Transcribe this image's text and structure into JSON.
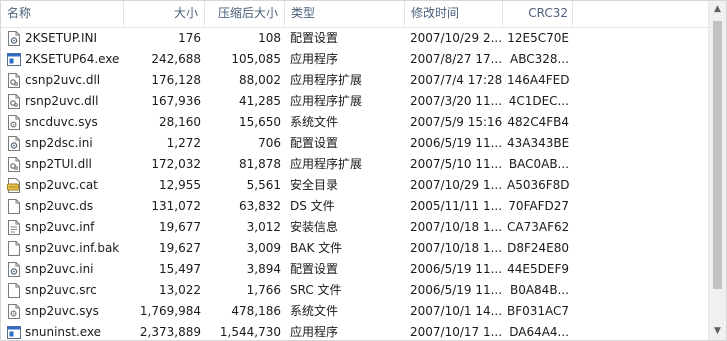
{
  "columns": {
    "name": "名称",
    "size": "大小",
    "compressed": "压缩后大小",
    "type": "类型",
    "modified": "修改时间",
    "crc": "CRC32"
  },
  "scrollbar": {
    "up": "▲",
    "down": "▼"
  },
  "sort_arrow": "^",
  "files": [
    {
      "icon": "ini-settings-icon",
      "name": "2KSETUP.INI",
      "size": "176",
      "compressed": "108",
      "type": "配置设置",
      "modified": "2007/10/29 2...",
      "crc": "12E5C70E"
    },
    {
      "icon": "exe-app-icon",
      "name": "2KSETUP64.exe",
      "size": "242,688",
      "compressed": "105,085",
      "type": "应用程序",
      "modified": "2007/8/27 17...",
      "crc": "ABC328..."
    },
    {
      "icon": "dll-extension-icon",
      "name": "csnp2uvc.dll",
      "size": "176,128",
      "compressed": "88,002",
      "type": "应用程序扩展",
      "modified": "2007/7/4 17:28",
      "crc": "146A4FED"
    },
    {
      "icon": "dll-extension-icon",
      "name": "rsnp2uvc.dll",
      "size": "167,936",
      "compressed": "41,285",
      "type": "应用程序扩展",
      "modified": "2007/3/20 11...",
      "crc": "4C1DEC..."
    },
    {
      "icon": "sys-file-icon",
      "name": "sncduvc.sys",
      "size": "28,160",
      "compressed": "15,650",
      "type": "系统文件",
      "modified": "2007/5/9 15:16",
      "crc": "482C4FB4"
    },
    {
      "icon": "ini-settings-icon",
      "name": "snp2dsc.ini",
      "size": "1,272",
      "compressed": "706",
      "type": "配置设置",
      "modified": "2006/5/19 11...",
      "crc": "43A343BE"
    },
    {
      "icon": "dll-extension-icon",
      "name": "snp2TUI.dll",
      "size": "172,032",
      "compressed": "81,878",
      "type": "应用程序扩展",
      "modified": "2007/5/10 11...",
      "crc": "BAC0AB..."
    },
    {
      "icon": "cat-catalog-icon",
      "name": "snp2uvc.cat",
      "size": "12,955",
      "compressed": "5,561",
      "type": "安全目录",
      "modified": "2007/10/29 1...",
      "crc": "A5036F8D"
    },
    {
      "icon": "blank-file-icon",
      "name": "snp2uvc.ds",
      "size": "131,072",
      "compressed": "63,832",
      "type": "DS 文件",
      "modified": "2005/11/11 1...",
      "crc": "70FAFD27"
    },
    {
      "icon": "inf-setup-icon",
      "name": "snp2uvc.inf",
      "size": "19,677",
      "compressed": "3,012",
      "type": "安装信息",
      "modified": "2007/10/18 1...",
      "crc": "CA73AF62"
    },
    {
      "icon": "blank-file-icon",
      "name": "snp2uvc.inf.bak",
      "size": "19,627",
      "compressed": "3,009",
      "type": "BAK 文件",
      "modified": "2007/10/18 1...",
      "crc": "D8F24E80"
    },
    {
      "icon": "ini-settings-icon",
      "name": "snp2uvc.ini",
      "size": "15,497",
      "compressed": "3,894",
      "type": "配置设置",
      "modified": "2006/5/19 11...",
      "crc": "44E5DEF9"
    },
    {
      "icon": "blank-file-icon",
      "name": "snp2uvc.src",
      "size": "13,022",
      "compressed": "1,766",
      "type": "SRC 文件",
      "modified": "2006/5/19 11...",
      "crc": "B0A84B..."
    },
    {
      "icon": "sys-file-icon",
      "name": "snp2uvc.sys",
      "size": "1,769,984",
      "compressed": "478,186",
      "type": "系统文件",
      "modified": "2007/10/1 14...",
      "crc": "BF031AC7"
    },
    {
      "icon": "exe-app-icon",
      "name": "snuninst.exe",
      "size": "2,373,889",
      "compressed": "1,544,730",
      "type": "应用程序",
      "modified": "2007/10/17 1...",
      "crc": "DA64A4..."
    }
  ]
}
